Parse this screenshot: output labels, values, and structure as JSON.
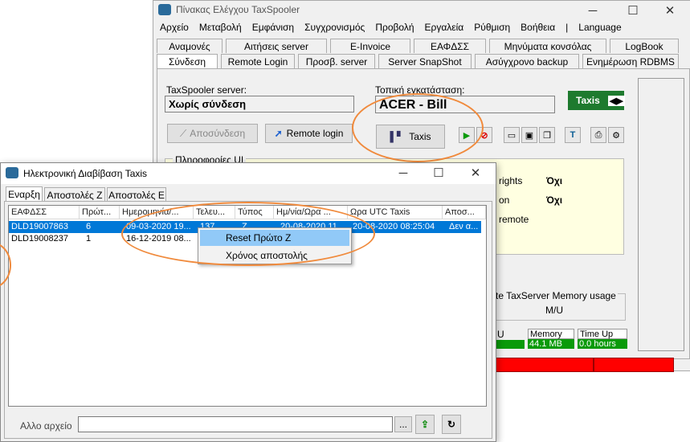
{
  "main_window": {
    "title": "Πίνακας Ελέγχου TaxSpooler",
    "menu": [
      "Αρχείο",
      "Μεταβολή",
      "Εμφάνιση",
      "Συγχρονισμός",
      "Προβολή",
      "Εργαλεία",
      "Ρύθμιση",
      "Βοήθεια",
      "|",
      "Language"
    ],
    "tabs_row1": [
      "Αναμονές",
      "Αιτήσεις server",
      "E-Invoice",
      "ΕΑΦΔΣΣ",
      "Μηνύματα κονσόλας",
      "LogBook"
    ],
    "tabs_row2": [
      "Σύνδεση",
      "Remote Login",
      "Προσβ. server",
      "Server SnapShot",
      "Ασύγχρονο backup",
      "Ενημέρωση RDBMS"
    ],
    "server_label": "TaxSpooler server:",
    "server_value": "Χωρίς σύνδεση",
    "local_label": "Τοπική εγκατάσταση:",
    "local_value": "ACER - Bill",
    "taxis_badge": "Taxis",
    "disconnect_button": "Αποσύνδεση",
    "remote_login_button": "Remote login",
    "taxis_button": "Taxis",
    "info_label": "Πληροφορίες UI",
    "info_rows": [
      {
        "key": "rights",
        "value": "Όχι"
      },
      {
        "key": "on",
        "value": "Όχι"
      },
      {
        "key": "remote",
        "value": ""
      }
    ],
    "memory_group": "te TaxServer Memory usage",
    "memory_value": "M/U",
    "stats": [
      {
        "label": "U",
        "value": ""
      },
      {
        "label": "Memory",
        "value": "44.1 MB"
      },
      {
        "label": "Time Up",
        "value": "0.0 hours"
      }
    ]
  },
  "dialog": {
    "title": "Ηλεκτρονική Διαβίβαση Taxis",
    "tabs": [
      "Εναρξη",
      "Αποστολές Ζ",
      "Αποστολές Ε"
    ],
    "columns": [
      "ΕΑΦΔΣΣ",
      "Πρώτ...",
      "Ημερομηνία/...",
      "Τελευ...",
      "Τύπος",
      "Ημ/νία/Ωρα ...",
      "Ωρα UTC Taxis",
      "Αποσ..."
    ],
    "rows": [
      [
        "DLD19007863",
        "6",
        "09-03-2020 19...",
        "137",
        "Ζ",
        "20-08-2020 11...",
        "20-08-2020 08:25:04",
        "Δεν α..."
      ],
      [
        "DLD19008237",
        "1",
        "16-12-2019 08...",
        "",
        "",
        "",
        "",
        ""
      ]
    ],
    "context_menu": [
      "Reset Πρώτο Ζ",
      "Χρόνος αποστολής"
    ],
    "file_label": "Αλλο αρχείο",
    "file_value": "",
    "browse_label": "..."
  },
  "colors": {
    "accent_orange": "#f08a3c",
    "taxis_green": "#1e7a2e",
    "stat_green": "#0a9a0a",
    "status_red": "#ff0000",
    "info_bg": "#ffffe1",
    "selection": "#0078d7"
  },
  "icons": [
    "app-logo-icon",
    "play-icon",
    "stop-icon",
    "monitor-icon",
    "upload-icon",
    "refresh-icon"
  ]
}
